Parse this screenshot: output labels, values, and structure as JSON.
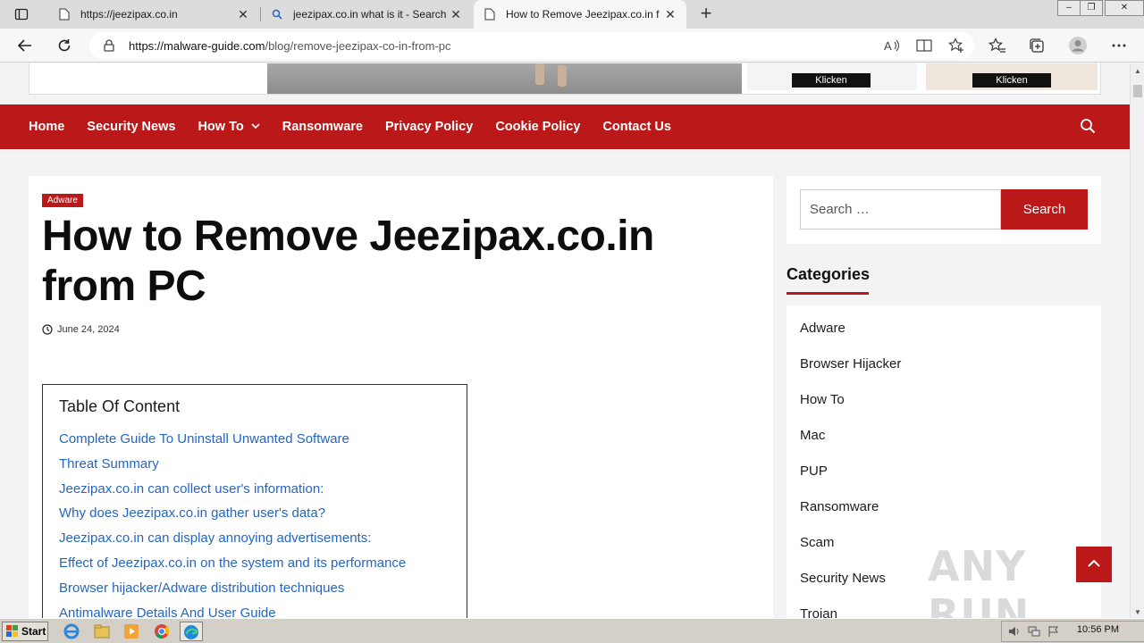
{
  "browser": {
    "tabs": [
      {
        "title": "https://jeezipax.co.in",
        "icon": "page-icon"
      },
      {
        "title": "jeezipax.co.in what is it - Search",
        "icon": "search-icon"
      },
      {
        "title": "How to Remove Jeezipax.co.in f",
        "icon": "page-icon",
        "active": true
      }
    ],
    "url_domain": "https://malware-guide.com",
    "url_path": "/blog/remove-jeezipax-co-in-from-pc"
  },
  "ad": {
    "button_1": "Klicken",
    "button_2": "Klicken"
  },
  "nav": {
    "items": [
      "Home",
      "Security News",
      "How To",
      "Ransomware",
      "Privacy Policy",
      "Cookie Policy",
      "Contact Us"
    ]
  },
  "article": {
    "category": "Adware",
    "title": "How to Remove Jeezipax.co.in from PC",
    "date": "June 24, 2024",
    "toc_title": "Table Of Content",
    "toc": [
      "Complete Guide To Uninstall Unwanted Software",
      "Threat Summary",
      "Jeezipax.co.in can collect user's information:",
      "Why does Jeezipax.co.in gather user's data?",
      "Jeezipax.co.in can display annoying advertisements:",
      "Effect of Jeezipax.co.in on the system and its performance",
      "Browser hijacker/Adware distribution techniques",
      "Antimalware Details And User Guide"
    ]
  },
  "sidebar": {
    "search_placeholder": "Search …",
    "search_button": "Search",
    "categories_heading": "Categories",
    "categories": [
      "Adware",
      "Browser Hijacker",
      "How To",
      "Mac",
      "PUP",
      "Ransomware",
      "Scam",
      "Security News",
      "Trojan"
    ]
  },
  "watermark": "ANY RUN",
  "taskbar": {
    "start": "Start",
    "time": "10:56 PM"
  },
  "colors": {
    "brand_red": "#bb1919",
    "link_blue": "#2566c2"
  }
}
